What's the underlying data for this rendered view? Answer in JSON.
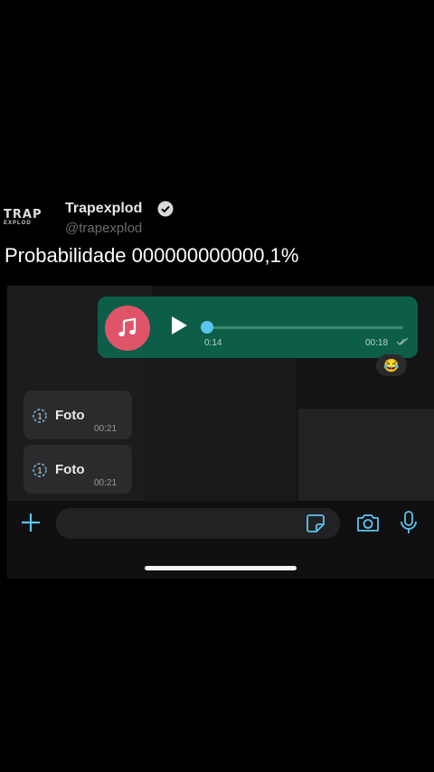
{
  "tweet": {
    "logo_line1": "TRAP",
    "logo_line2": "EXPLOD",
    "author": "Trapexplod",
    "handle": "@trapexplod",
    "text": "Probabilidade 000000000000,1%"
  },
  "chat": {
    "voice_message": {
      "elapsed": "0:14",
      "time": "00:18",
      "reaction": "😂",
      "avatar_icon": "music-note-icon",
      "accent_color": "#0c5e48",
      "avatar_color": "#e0546a"
    },
    "photo_messages": [
      {
        "label": "Foto",
        "time": "00:21",
        "icon": "view-once-icon"
      },
      {
        "label": "Foto",
        "time": "00:21",
        "icon": "view-once-icon"
      }
    ]
  },
  "input_bar": {
    "placeholder": "",
    "icons": [
      "plus-icon",
      "sticker-icon",
      "camera-icon",
      "microphone-icon"
    ]
  }
}
